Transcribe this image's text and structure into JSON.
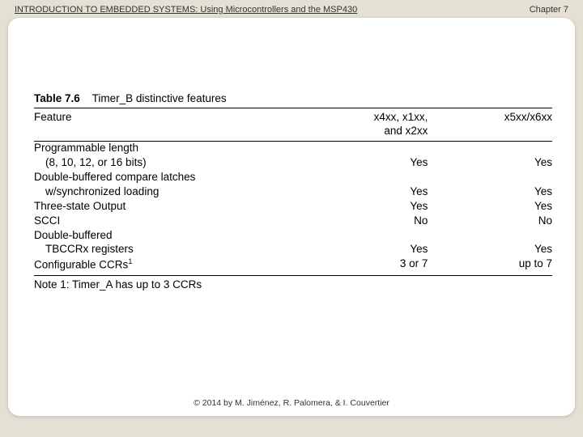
{
  "header": {
    "title": "INTRODUCTION TO EMBEDDED SYSTEMS: Using Microcontrollers and the MSP430",
    "chapter": "Chapter 7"
  },
  "table": {
    "label": "Table 7.6",
    "title": "Timer_B distinctive features",
    "col1": "Feature",
    "col2_line1": "x4xx, x1xx,",
    "col2_line2": "and x2xx",
    "col3": "x5xx/x6xx",
    "rows": [
      {
        "f1": "Programmable length",
        "f2": "(8, 10, 12, or 16 bits)",
        "v1": "Yes",
        "v2": "Yes"
      },
      {
        "f1": "Double-buffered compare latches",
        "f2": "w/synchronized loading",
        "v1": "Yes",
        "v2": "Yes"
      },
      {
        "f1": "Three-state Output",
        "f2": "",
        "v1": "Yes",
        "v2": "Yes"
      },
      {
        "f1": "SCCI",
        "f2": "",
        "v1": "No",
        "v2": "No"
      },
      {
        "f1": "Double-buffered",
        "f2": "TBCCRx registers",
        "v1": "Yes",
        "v2": "Yes"
      },
      {
        "f1": "Configurable CCRs",
        "sup": "1",
        "f2": "",
        "v1": "3 or 7",
        "v2": "up to 7"
      }
    ],
    "note": "Note 1: Timer_A has up to 3 CCRs"
  },
  "footer": "© 2014 by M. Jiménez, R. Palomera, & I. Couvertier"
}
